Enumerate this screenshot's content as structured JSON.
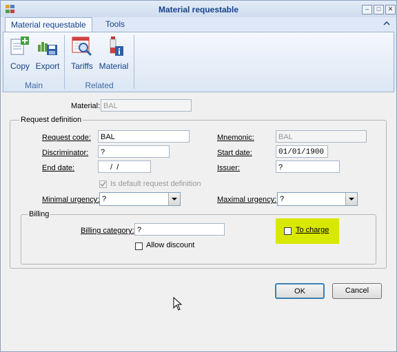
{
  "window": {
    "title": "Material requestable"
  },
  "ribbon": {
    "tabs": [
      {
        "label": "Material requestable"
      },
      {
        "label": "Tools"
      }
    ],
    "groups": [
      {
        "label": "Main",
        "buttons": [
          {
            "label": "Copy",
            "icon": "copy-icon"
          },
          {
            "label": "Export",
            "icon": "export-icon"
          }
        ]
      },
      {
        "label": "Related",
        "buttons": [
          {
            "label": "Tariffs",
            "icon": "tariffs-icon"
          },
          {
            "label": "Material",
            "icon": "material-icon"
          }
        ]
      }
    ]
  },
  "form": {
    "material": {
      "label": "Material:",
      "value": "BAL"
    },
    "request_definition": {
      "title": "Request definition",
      "request_code": {
        "label": "Request code:",
        "value": "BAL"
      },
      "mnemonic": {
        "label": "Mnemonic:",
        "value": "BAL"
      },
      "discriminator": {
        "label": "Discriminator:",
        "value": "?"
      },
      "start_date": {
        "label": "Start date:",
        "value": "01/01/1900"
      },
      "end_date": {
        "label": "End date:",
        "value": " /  /"
      },
      "issuer": {
        "label": "Issuer:",
        "value": "?"
      },
      "is_default": {
        "label": "Is default request definition",
        "checked": true
      },
      "minimal_urgency": {
        "label": "Minimal urgency:",
        "value": "?"
      },
      "maximal_urgency": {
        "label": "Maximal urgency:",
        "value": "?"
      }
    },
    "billing": {
      "title": "Billing",
      "billing_category": {
        "label": "Billing category:",
        "value": "?"
      },
      "to_charge": {
        "label": "To charge",
        "checked": false
      },
      "allow_discount": {
        "label": "Allow discount",
        "checked": false
      }
    }
  },
  "buttons": {
    "ok": "OK",
    "cancel": "Cancel"
  },
  "colors": {
    "title_text": "#15428b",
    "highlight": "#d8e800"
  }
}
